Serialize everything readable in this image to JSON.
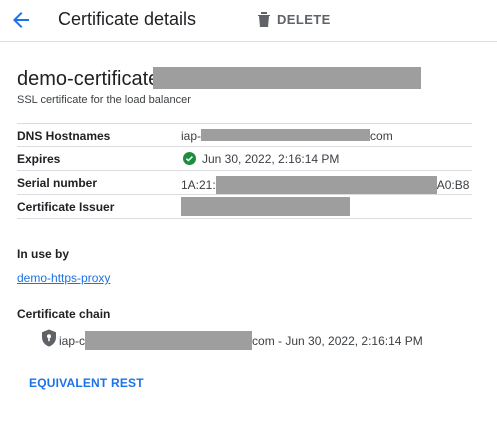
{
  "header": {
    "title": "Certificate details",
    "delete_label": "DELETE",
    "back_icon": "arrow-back-icon",
    "delete_icon": "trash-icon"
  },
  "certificate": {
    "name_prefix": "demo-certificate-",
    "description": "SSL certificate for the load balancer"
  },
  "details": [
    {
      "key": "DNS Hostnames",
      "value_prefix": "iap-",
      "value_suffix": "com"
    },
    {
      "key": "Expires",
      "value": "Jun 30, 2022, 2:16:14 PM",
      "status_icon": "check-circle-icon"
    },
    {
      "key": "Serial number",
      "value_prefix": "1A:21:",
      "value_suffix": "A0:B8"
    },
    {
      "key": "Certificate Issuer",
      "value": ""
    }
  ],
  "in_use": {
    "label": "In use by",
    "link": "demo-https-proxy"
  },
  "chain": {
    "label": "Certificate chain",
    "item_prefix": "iap-c",
    "item_suffix": "com - Jun 30, 2022, 2:16:14 PM",
    "icon": "shield-lock-icon"
  },
  "footer": {
    "equivalent_rest": "EQUIVALENT REST"
  },
  "colors": {
    "accent": "#1a73e8",
    "success": "#1e8e3e",
    "redaction": "#9e9e9e",
    "divider": "#dadce0"
  }
}
